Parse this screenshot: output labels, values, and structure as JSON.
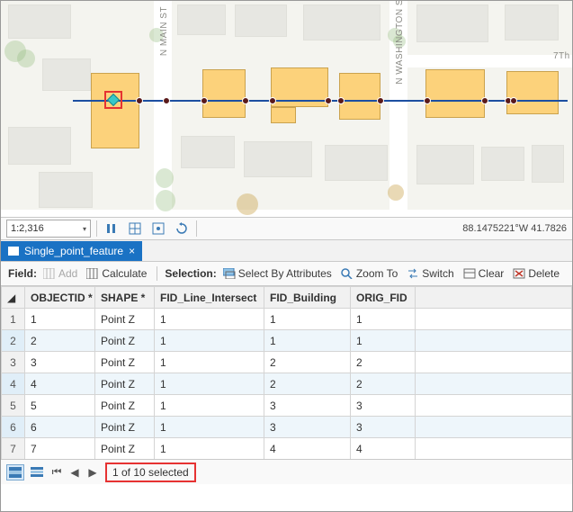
{
  "map": {
    "street_main": "N MAIN ST",
    "street_wash": "N WASHINGTON S",
    "street_7th": "7Th"
  },
  "scalebar": {
    "scale": "1:2,316",
    "coords": "88.1475221°W 41.7826"
  },
  "tab": {
    "title": "Single_point_feature",
    "close": "×"
  },
  "toolbar": {
    "field_label": "Field:",
    "add": "Add",
    "calculate": "Calculate",
    "selection_label": "Selection:",
    "select_by_attributes": "Select By Attributes",
    "zoom_to": "Zoom To",
    "switch": "Switch",
    "clear": "Clear",
    "delete": "Delete"
  },
  "table": {
    "columns": [
      "OBJECTID *",
      "SHAPE *",
      "FID_Line_Intersect",
      "FID_Building",
      "ORIG_FID"
    ],
    "rows": [
      {
        "n": 1,
        "objectid": "1",
        "shape": "Point Z",
        "fid_line": 1,
        "fid_bld": 1,
        "orig": 1,
        "sel": false
      },
      {
        "n": 2,
        "objectid": "2",
        "shape": "Point Z",
        "fid_line": 1,
        "fid_bld": 1,
        "orig": 1,
        "sel": true
      },
      {
        "n": 3,
        "objectid": "3",
        "shape": "Point Z",
        "fid_line": 1,
        "fid_bld": 2,
        "orig": 2,
        "sel": false
      },
      {
        "n": 4,
        "objectid": "4",
        "shape": "Point Z",
        "fid_line": 1,
        "fid_bld": 2,
        "orig": 2,
        "sel": true
      },
      {
        "n": 5,
        "objectid": "5",
        "shape": "Point Z",
        "fid_line": 1,
        "fid_bld": 3,
        "orig": 3,
        "sel": false
      },
      {
        "n": 6,
        "objectid": "6",
        "shape": "Point Z",
        "fid_line": 1,
        "fid_bld": 3,
        "orig": 3,
        "sel": true
      },
      {
        "n": 7,
        "objectid": "7",
        "shape": "Point Z",
        "fid_line": 1,
        "fid_bld": 4,
        "orig": 4,
        "sel": false
      }
    ]
  },
  "footer": {
    "status": "1 of 10 selected"
  }
}
